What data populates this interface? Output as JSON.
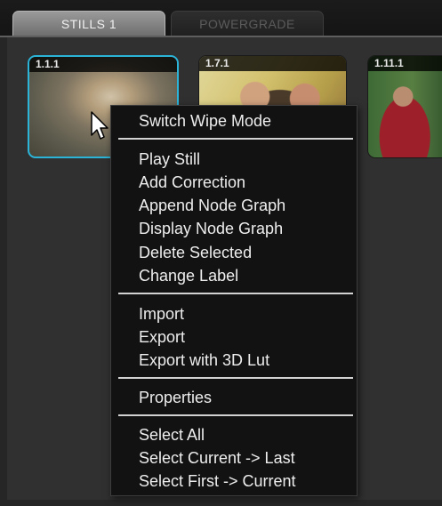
{
  "tabs": [
    {
      "label": "STILLS 1",
      "active": true
    },
    {
      "label": "POWERGRADE",
      "active": false
    }
  ],
  "stills": [
    {
      "label": "1.1.1",
      "selected": true
    },
    {
      "label": "1.7.1",
      "selected": false
    },
    {
      "label": "1.11.1",
      "selected": false
    }
  ],
  "context_menu": {
    "groups": [
      [
        "Switch Wipe Mode"
      ],
      [
        "Play Still",
        "Add Correction",
        "Append Node Graph",
        "Display Node Graph",
        "Delete Selected",
        "Change Label"
      ],
      [
        "Import",
        "Export",
        "Export with 3D Lut"
      ],
      [
        "Properties"
      ],
      [
        "Select All",
        "Select Current -> Last",
        "Select First -> Current"
      ]
    ]
  },
  "colors": {
    "selection_border": "#2bb4d8",
    "menu_background": "#121212",
    "menu_text": "#eeeeee"
  },
  "icons": {
    "cursor": "arrow-cursor-icon"
  }
}
